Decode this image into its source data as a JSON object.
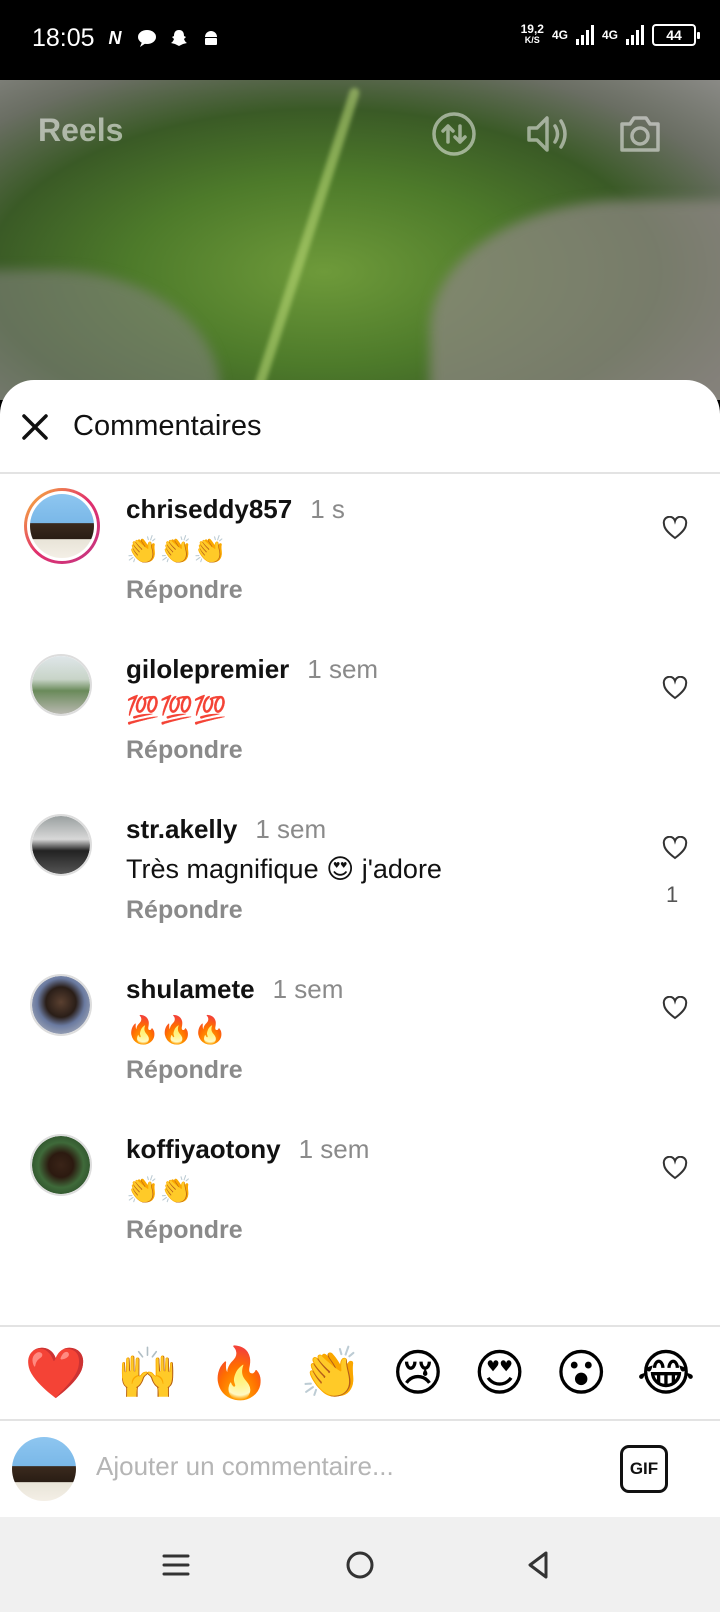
{
  "status": {
    "time": "18:05",
    "speed_top": "19,2",
    "speed_unit": "K/S",
    "net1": "4G",
    "net2": "4G",
    "battery": "44"
  },
  "reel": {
    "title": "Reels"
  },
  "sheet": {
    "title": "Commentaires"
  },
  "comments": [
    {
      "user": "chriseddy857",
      "time": "1 s",
      "text": "👏👏👏",
      "reply": "Répondre",
      "likes": ""
    },
    {
      "user": "gilolepremier",
      "time": "1 sem",
      "text": "💯💯💯",
      "reply": "Répondre",
      "likes": ""
    },
    {
      "user": "str.akelly",
      "time": "1 sem",
      "text": "Très magnifique 😍 j'adore",
      "reply": "Répondre",
      "likes": "1"
    },
    {
      "user": "shulamete",
      "time": "1 sem",
      "text": "🔥🔥🔥",
      "reply": "Répondre",
      "likes": ""
    },
    {
      "user": "koffiyaotony",
      "time": "1 sem",
      "text": "👏👏",
      "reply": "Répondre",
      "likes": ""
    }
  ],
  "reactions": [
    "❤️",
    "🙌",
    "🔥",
    "👏",
    "😢",
    "😍",
    "😮",
    "😂"
  ],
  "composer": {
    "placeholder": "Ajouter un commentaire...",
    "gif_label": "GIF"
  },
  "colors": {
    "accent_story_ring": "#e1306c",
    "muted_text": "#8a8a8a"
  }
}
